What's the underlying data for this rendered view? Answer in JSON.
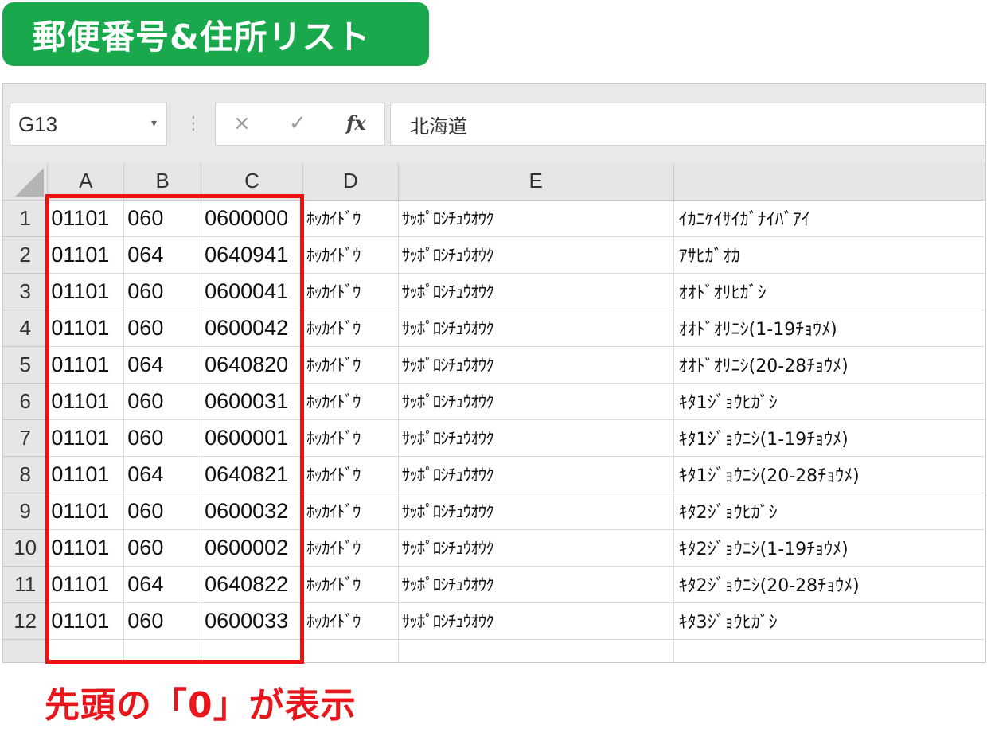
{
  "title": "郵便番号&住所リスト",
  "formula_bar": {
    "name_box": "G13",
    "name_box_dropdown": "▾",
    "separator": "⋮",
    "cancel_icon": "×",
    "enter_icon": "✓",
    "fx_icon": "fx",
    "formula_value": "北海道"
  },
  "grid": {
    "columns": [
      "A",
      "B",
      "C",
      "D",
      "E",
      ""
    ],
    "rows": [
      {
        "num": "1",
        "a": "01101",
        "b": "060",
        "c": "0600000",
        "d": "ﾎｯｶｲﾄﾞｳ",
        "e": "ｻｯﾎﾟﾛｼﾁｭｳｵｳｸ",
        "f": "ｲｶﾆｹｲｻｲｶﾞﾅｲﾊﾞｱｲ"
      },
      {
        "num": "2",
        "a": "01101",
        "b": "064",
        "c": "0640941",
        "d": "ﾎｯｶｲﾄﾞｳ",
        "e": "ｻｯﾎﾟﾛｼﾁｭｳｵｳｸ",
        "f": "ｱｻﾋｶﾞｵｶ"
      },
      {
        "num": "3",
        "a": "01101",
        "b": "060",
        "c": "0600041",
        "d": "ﾎｯｶｲﾄﾞｳ",
        "e": "ｻｯﾎﾟﾛｼﾁｭｳｵｳｸ",
        "f": "ｵｵﾄﾞｵﾘﾋｶﾞｼ"
      },
      {
        "num": "4",
        "a": "01101",
        "b": "060",
        "c": "0600042",
        "d": "ﾎｯｶｲﾄﾞｳ",
        "e": "ｻｯﾎﾟﾛｼﾁｭｳｵｳｸ",
        "f": "ｵｵﾄﾞｵﾘﾆｼ(1-19ﾁｮｳﾒ)"
      },
      {
        "num": "5",
        "a": "01101",
        "b": "064",
        "c": "0640820",
        "d": "ﾎｯｶｲﾄﾞｳ",
        "e": "ｻｯﾎﾟﾛｼﾁｭｳｵｳｸ",
        "f": "ｵｵﾄﾞｵﾘﾆｼ(20-28ﾁｮｳﾒ)"
      },
      {
        "num": "6",
        "a": "01101",
        "b": "060",
        "c": "0600031",
        "d": "ﾎｯｶｲﾄﾞｳ",
        "e": "ｻｯﾎﾟﾛｼﾁｭｳｵｳｸ",
        "f": "ｷﾀ1ｼﾞｮｳﾋｶﾞｼ"
      },
      {
        "num": "7",
        "a": "01101",
        "b": "060",
        "c": "0600001",
        "d": "ﾎｯｶｲﾄﾞｳ",
        "e": "ｻｯﾎﾟﾛｼﾁｭｳｵｳｸ",
        "f": "ｷﾀ1ｼﾞｮｳﾆｼ(1-19ﾁｮｳﾒ)"
      },
      {
        "num": "8",
        "a": "01101",
        "b": "064",
        "c": "0640821",
        "d": "ﾎｯｶｲﾄﾞｳ",
        "e": "ｻｯﾎﾟﾛｼﾁｭｳｵｳｸ",
        "f": "ｷﾀ1ｼﾞｮｳﾆｼ(20-28ﾁｮｳﾒ)"
      },
      {
        "num": "9",
        "a": "01101",
        "b": "060",
        "c": "0600032",
        "d": "ﾎｯｶｲﾄﾞｳ",
        "e": "ｻｯﾎﾟﾛｼﾁｭｳｵｳｸ",
        "f": "ｷﾀ2ｼﾞｮｳﾋｶﾞｼ"
      },
      {
        "num": "10",
        "a": "01101",
        "b": "060",
        "c": "0600002",
        "d": "ﾎｯｶｲﾄﾞｳ",
        "e": "ｻｯﾎﾟﾛｼﾁｭｳｵｳｸ",
        "f": "ｷﾀ2ｼﾞｮｳﾆｼ(1-19ﾁｮｳﾒ)"
      },
      {
        "num": "11",
        "a": "01101",
        "b": "064",
        "c": "0640822",
        "d": "ﾎｯｶｲﾄﾞｳ",
        "e": "ｻｯﾎﾟﾛｼﾁｭｳｵｳｸ",
        "f": "ｷﾀ2ｼﾞｮｳﾆｼ(20-28ﾁｮｳﾒ)"
      },
      {
        "num": "12",
        "a": "01101",
        "b": "060",
        "c": "0600033",
        "d": "ﾎｯｶｲﾄﾞｳ",
        "e": "ｻｯﾎﾟﾛｼﾁｭｳｵｳｸ",
        "f": "ｷﾀ3ｼﾞｮｳﾋｶﾞｼ"
      }
    ]
  },
  "caption": "先頭の「0」が表示",
  "colors": {
    "title_bg": "#1aa84d",
    "highlight": "#ee1111",
    "caption": "#e8151b"
  }
}
